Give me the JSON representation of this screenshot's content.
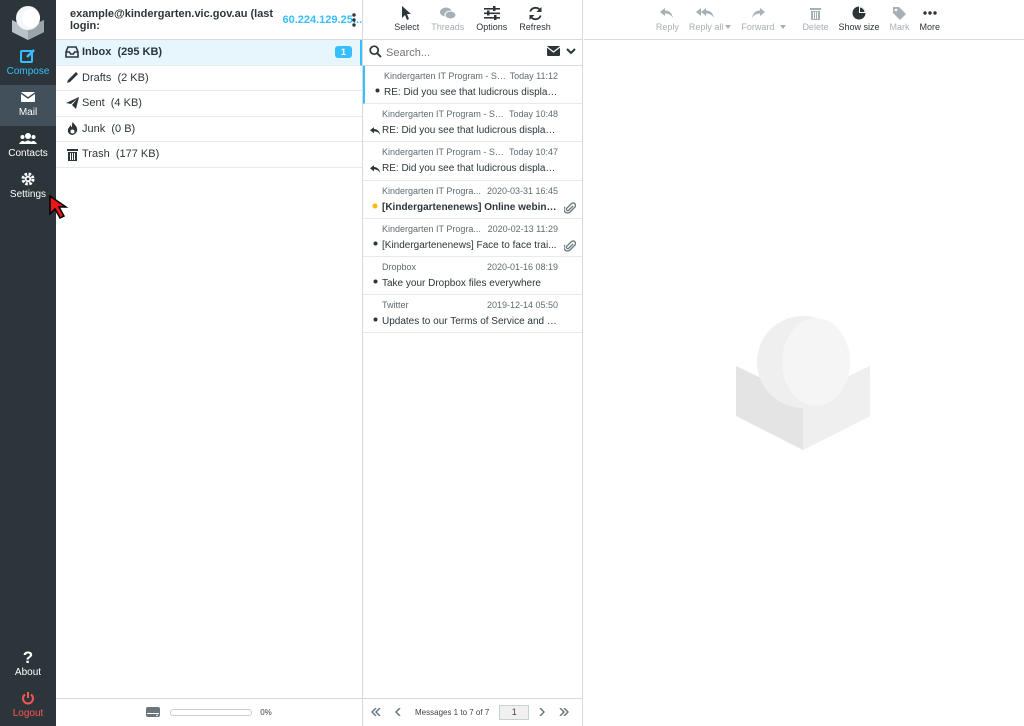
{
  "nav": {
    "compose": "Compose",
    "mail": "Mail",
    "contacts": "Contacts",
    "settings": "Settings",
    "about": "About",
    "logout": "Logout"
  },
  "account": {
    "label": "example@kindergarten.vic.gov.au (last login:",
    "ip": "60.224.129.25..."
  },
  "folders": [
    {
      "name": "Inbox",
      "size": "(295 KB)",
      "unread": "1"
    },
    {
      "name": "Drafts",
      "size": "(2 KB)"
    },
    {
      "name": "Sent",
      "size": "(4 KB)"
    },
    {
      "name": "Junk",
      "size": "(0 B)"
    },
    {
      "name": "Trash",
      "size": "(177 KB)"
    }
  ],
  "quota": {
    "percent": "0%",
    "fill": 0
  },
  "list_toolbar": {
    "select": "Select",
    "threads": "Threads",
    "options": "Options",
    "refresh": "Refresh"
  },
  "search": {
    "placeholder": "Search..."
  },
  "messages": [
    {
      "from": "Kindergarten IT Program - Su...",
      "date": "Today 11:12",
      "subject": "RE: Did you see that ludicrous display l...",
      "status": "dot",
      "bold": false,
      "attachment": false
    },
    {
      "from": "Kindergarten IT Program - Su...",
      "date": "Today 10:48",
      "subject": "RE: Did you see that ludicrous display l...",
      "status": "replied",
      "bold": false,
      "attachment": false
    },
    {
      "from": "Kindergarten IT Program - Su...",
      "date": "Today 10:47",
      "subject": "RE: Did you see that ludicrous display l...",
      "status": "replied",
      "bold": false,
      "attachment": false
    },
    {
      "from": "Kindergarten IT Progra...",
      "date": "2020-03-31 16:45",
      "subject": "[Kindergartenenews] Online webinars...",
      "status": "unread",
      "bold": true,
      "attachment": true
    },
    {
      "from": "Kindergarten IT Progra...",
      "date": "2020-02-13 11:29",
      "subject": "[Kindergartenenews] Face to face trai...",
      "status": "dot",
      "bold": false,
      "attachment": true
    },
    {
      "from": "Dropbox",
      "date": "2020-01-16 08:19",
      "subject": "Take your Dropbox files everywhere",
      "status": "dot",
      "bold": false,
      "attachment": false
    },
    {
      "from": "Twitter",
      "date": "2019-12-14 05:50",
      "subject": "Updates to our Terms of Service and P...",
      "status": "dot",
      "bold": false,
      "attachment": false
    }
  ],
  "pagination": {
    "count_text": "Messages 1 to 7 of 7",
    "page": "1"
  },
  "preview_toolbar": {
    "reply": "Reply",
    "reply_all": "Reply all",
    "forward": "Forward",
    "delete": "Delete",
    "show_size": "Show size",
    "mark": "Mark",
    "more": "More"
  },
  "colors": {
    "accent": "#37beff",
    "nav_bg": "#2c363a",
    "logout": "#ff5552",
    "unread_dot": "#ffb900"
  }
}
